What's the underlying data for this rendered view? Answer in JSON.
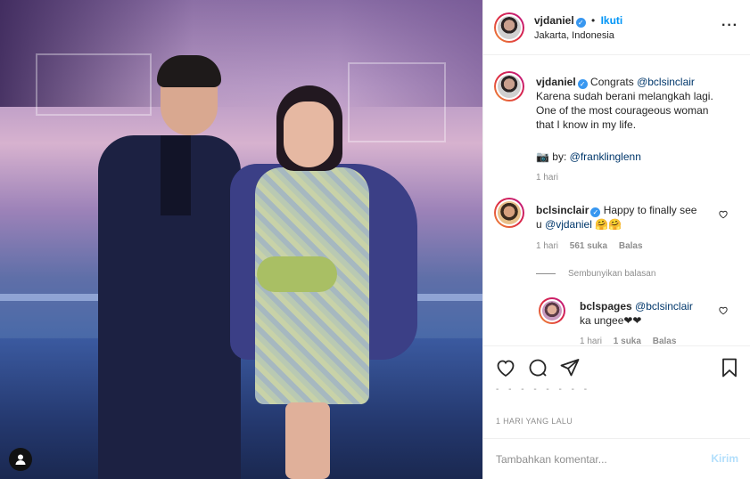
{
  "header": {
    "username": "vjdaniel",
    "follow_label": "Ikuti",
    "separator": "•",
    "location": "Jakarta, Indonesia",
    "more_label": "···"
  },
  "caption": {
    "username": "vjdaniel",
    "text_pre": "Congrats ",
    "mention1": "@bclsinclair",
    "line2": "Karena sudah berani melangkah lagi.",
    "line3": "One of the most courageous woman",
    "line4": "that I know in my life.",
    "credit_icon": "📷",
    "credit_pre": " by: ",
    "mention2": "@franklinglenn",
    "time": "1 hari"
  },
  "comment1": {
    "username": "bclsinclair",
    "text_pre": "Happy to finally see",
    "text_u": "u ",
    "mention": "@vjdaniel",
    "emoji": " 🤗🤗",
    "time": "1 hari",
    "likes": "561 suka",
    "reply_label": "Balas",
    "hide_replies": "Sembunyikan balasan"
  },
  "reply1": {
    "username": "bclspages",
    "mention": "@bclsinclair",
    "text": "ka ungee❤❤",
    "time": "1 hari",
    "likes": "1 suka",
    "reply_label": "Balas"
  },
  "likes_blur": "- - - - - - - -",
  "time_ago": "1 HARI YANG LALU",
  "composer": {
    "placeholder": "Tambahkan komentar...",
    "post_label": "Kirim"
  },
  "colors": {
    "link": "#00376b",
    "follow": "#0095f6",
    "verified": "#3897f0"
  },
  "icons": [
    "heart-icon",
    "comment-icon",
    "share-icon",
    "bookmark-icon",
    "user-tag-icon",
    "more-icon",
    "verified-icon"
  ]
}
